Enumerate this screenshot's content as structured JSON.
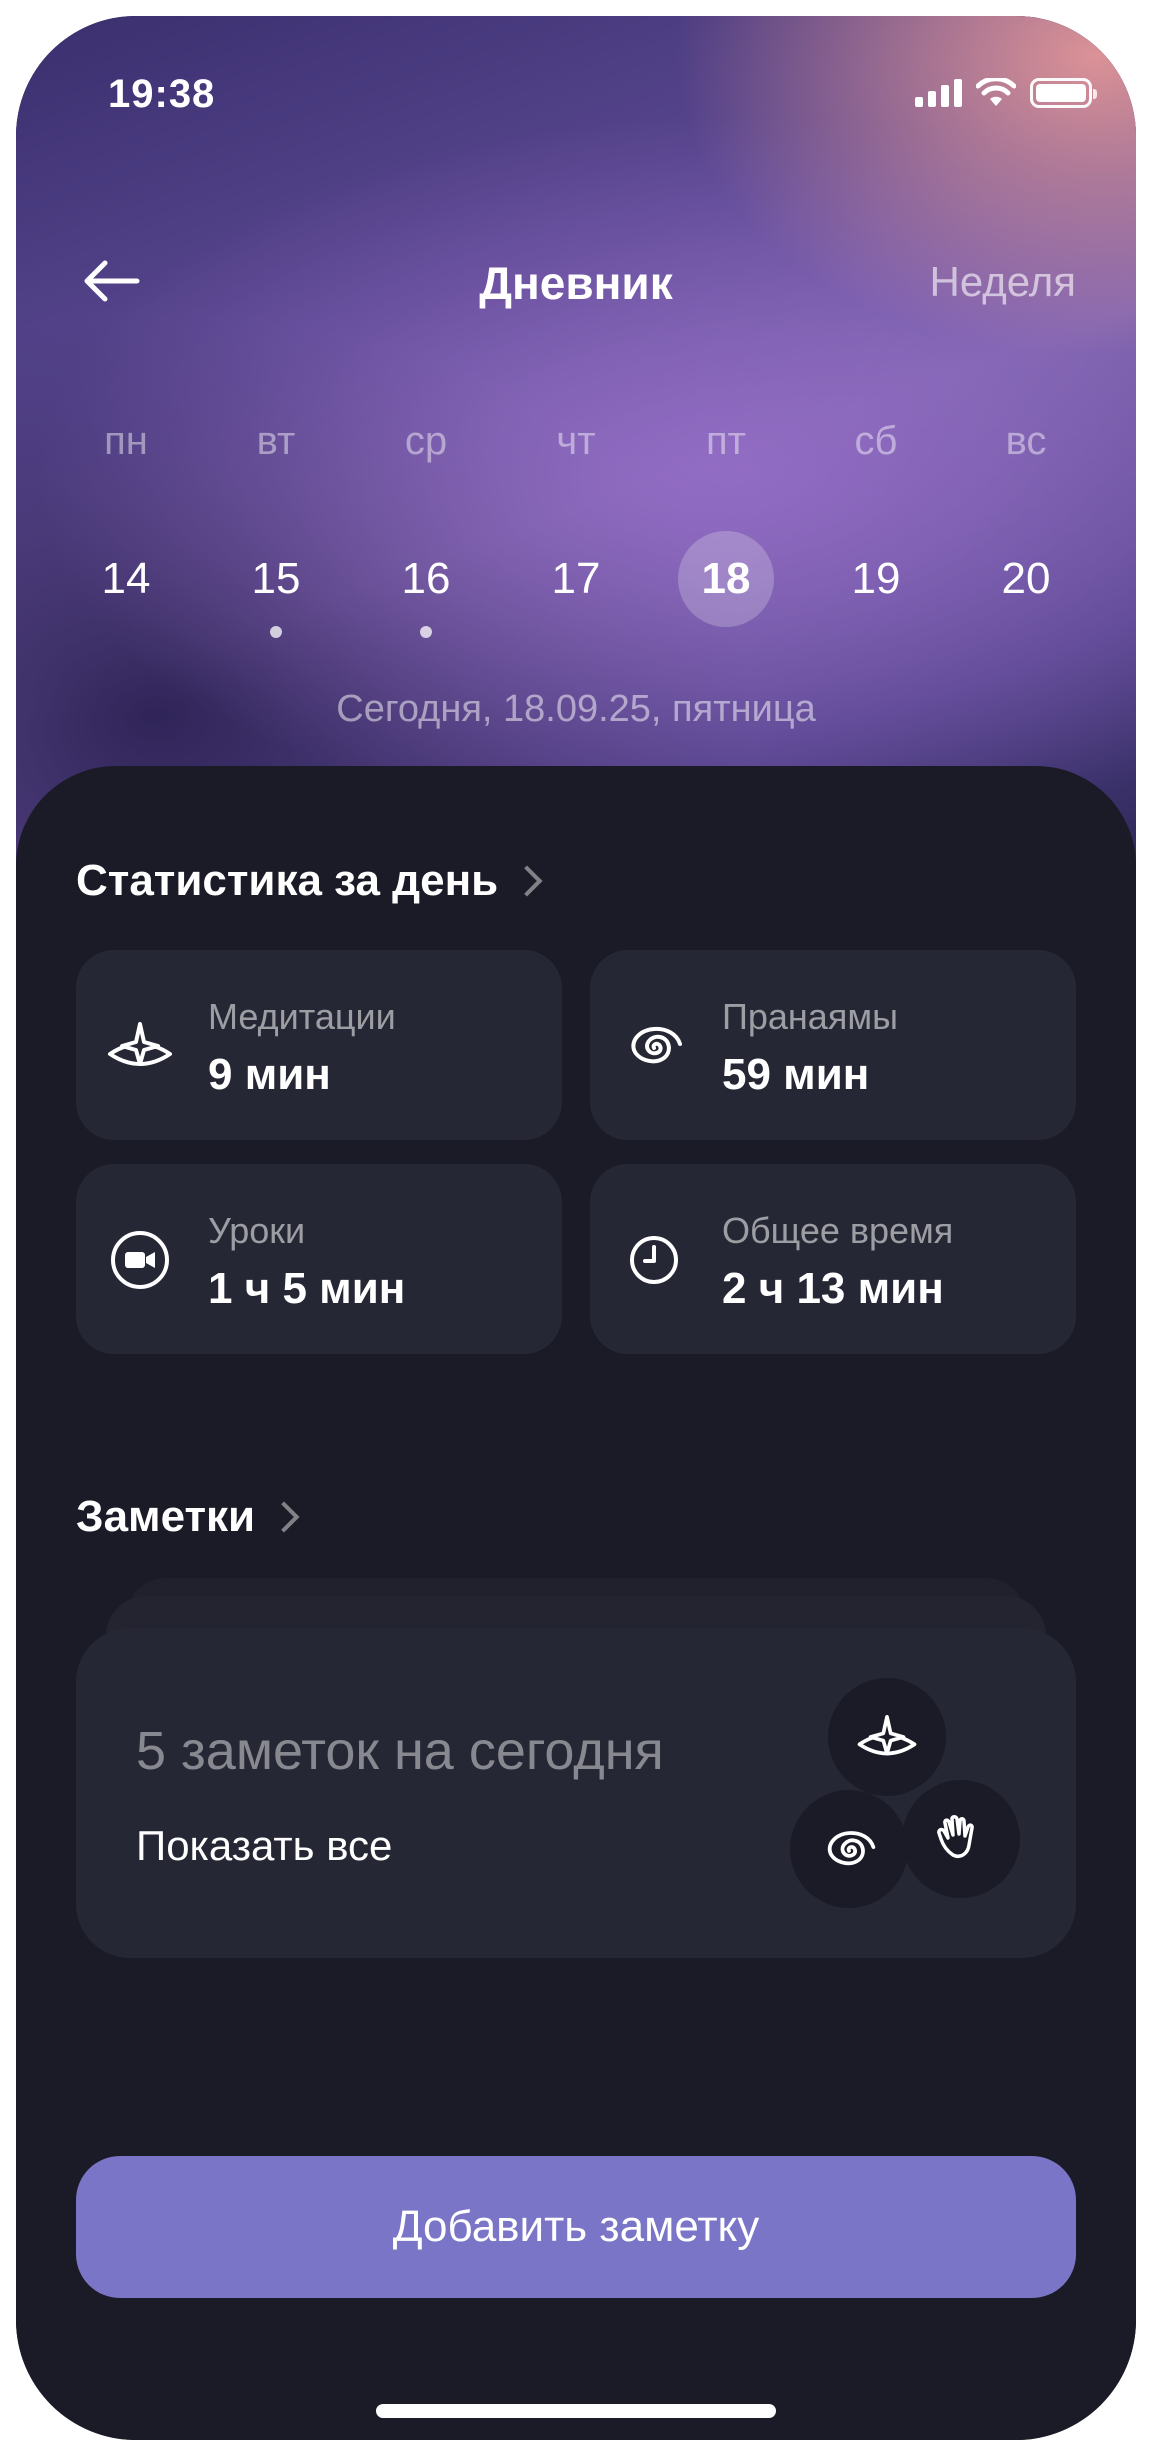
{
  "status_bar": {
    "time": "19:38"
  },
  "nav": {
    "title": "Дневник",
    "week_link": "Неделя"
  },
  "calendar": {
    "weekdays": [
      "пн",
      "вт",
      "ср",
      "чт",
      "пт",
      "сб",
      "вс"
    ],
    "days": [
      "14",
      "15",
      "16",
      "17",
      "18",
      "19",
      "20"
    ],
    "selected_day": "18",
    "days_with_entries": [
      "15",
      "16"
    ],
    "today_label": "Сегодня, 18.09.25, пятница"
  },
  "stats": {
    "title": "Статистика за день",
    "cards": [
      {
        "label": "Медитации",
        "value": "9 мин",
        "icon": "meditation-icon"
      },
      {
        "label": "Пранаямы",
        "value": "59 мин",
        "icon": "spiral-icon"
      },
      {
        "label": "Уроки",
        "value": "1 ч 5 мин",
        "icon": "video-icon"
      },
      {
        "label": "Общее время",
        "value": "2 ч 13 мин",
        "icon": "clock-icon"
      }
    ]
  },
  "notes": {
    "title": "Заметки",
    "count_text": "5 заметок на сегодня",
    "show_all": "Показать все",
    "icons": [
      "meditation-icon",
      "spiral-icon",
      "hand-icon"
    ]
  },
  "add_button": {
    "label": "Добавить заметку"
  },
  "colors": {
    "background": "#1a1b26",
    "card": "#262735",
    "accent": "#7a75c6"
  }
}
